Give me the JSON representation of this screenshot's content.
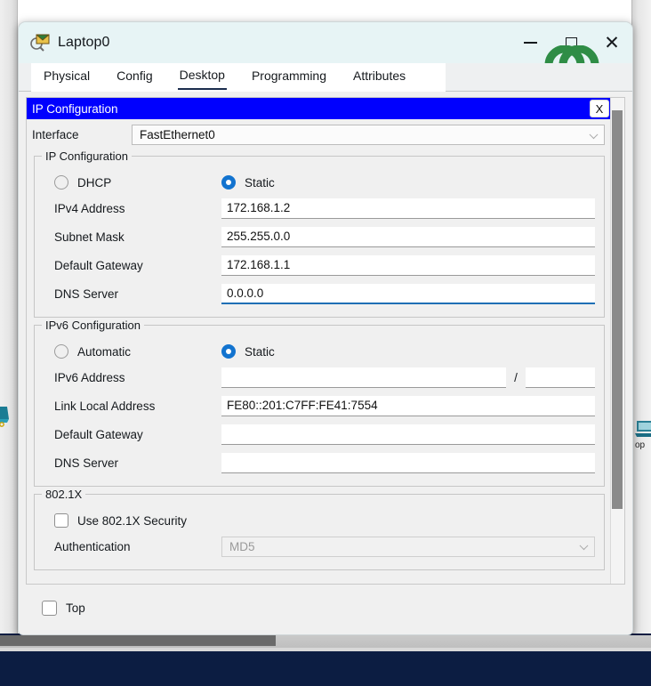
{
  "window": {
    "title": "Laptop0",
    "icon": "inspect-envelope-icon",
    "minimize_label": "minimize",
    "maximize_label": "maximize",
    "close_label": "✕",
    "watermark": "geeksforgeeks-logo"
  },
  "tabs": [
    {
      "label": "Physical",
      "active": false
    },
    {
      "label": "Config",
      "active": false
    },
    {
      "label": "Desktop",
      "active": true
    },
    {
      "label": "Programming",
      "active": false
    },
    {
      "label": "Attributes",
      "active": false
    }
  ],
  "panel": {
    "title": "IP Configuration",
    "close_label": "X"
  },
  "interface": {
    "label": "Interface",
    "value": "FastEthernet0"
  },
  "ipv4": {
    "group_title": "IP Configuration",
    "dhcp_label": "DHCP",
    "static_label": "Static",
    "mode": "static",
    "fields": [
      {
        "label": "IPv4 Address",
        "value": "172.168.1.2",
        "focused": false
      },
      {
        "label": "Subnet Mask",
        "value": "255.255.0.0",
        "focused": false
      },
      {
        "label": "Default Gateway",
        "value": "172.168.1.1",
        "focused": false
      },
      {
        "label": "DNS Server",
        "value": "0.0.0.0",
        "focused": true
      }
    ]
  },
  "ipv6": {
    "group_title": "IPv6 Configuration",
    "automatic_label": "Automatic",
    "static_label": "Static",
    "mode": "static",
    "address_label": "IPv6 Address",
    "address_value": "",
    "prefix_separator": "/",
    "prefix_value": "",
    "fields": [
      {
        "label": "Link Local Address",
        "value": "FE80::201:C7FF:FE41:7554"
      },
      {
        "label": "Default Gateway",
        "value": ""
      },
      {
        "label": "DNS Server",
        "value": ""
      }
    ]
  },
  "dot1x": {
    "group_title": "802.1X",
    "use_security_label": "Use 802.1X Security",
    "use_security_checked": false,
    "authentication_label": "Authentication",
    "authentication_value": "MD5",
    "authentication_disabled": true
  },
  "footer": {
    "top_label": "Top",
    "top_checked": false
  },
  "colors": {
    "panel_header": "#0000FE",
    "radio_selected": "#1273CF",
    "focus_underline": "#1F6FB5",
    "logo_green": "#2F8D46",
    "desktop": "#0F2350"
  }
}
